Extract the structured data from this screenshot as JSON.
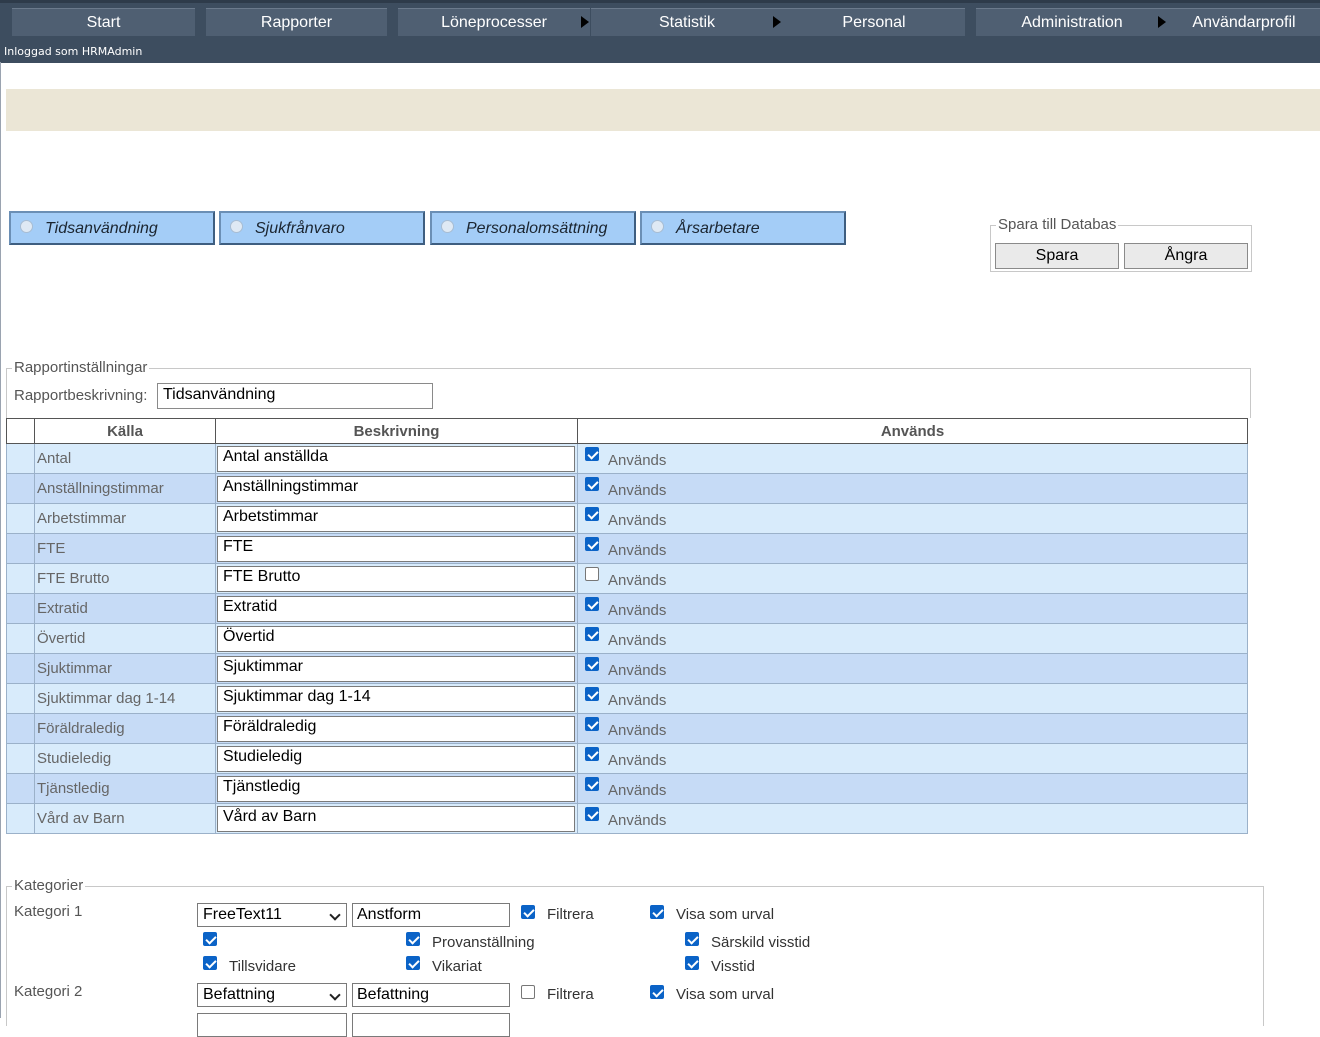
{
  "nav": {
    "items": [
      "Start",
      "Rapporter",
      "Löneprocesser",
      "Statistik",
      "Personal",
      "Administration",
      "Användarprofil"
    ],
    "logged_in": "Inloggad som HRMAdmin"
  },
  "report_tabs": [
    "Tidsanvändning",
    "Sjukfrånvaro",
    "Personalomsättning",
    "Årsarbetare"
  ],
  "save_panel": {
    "legend": "Spara till Databas",
    "save": "Spara",
    "undo": "Ångra"
  },
  "settings": {
    "legend": "Rapportinställningar",
    "description_label": "Rapportbeskrivning:",
    "description_value": "Tidsanvändning"
  },
  "table": {
    "headers": [
      "Källa",
      "Beskrivning",
      "Används"
    ],
    "used_label": "Används",
    "rows": [
      {
        "source": "Antal",
        "description": "Antal anställda",
        "used": true
      },
      {
        "source": "Anställningstimmar",
        "description": "Anställningstimmar",
        "used": true
      },
      {
        "source": "Arbetstimmar",
        "description": "Arbetstimmar",
        "used": true
      },
      {
        "source": "FTE",
        "description": "FTE",
        "used": true
      },
      {
        "source": "FTE Brutto",
        "description": "FTE Brutto",
        "used": false
      },
      {
        "source": "Extratid",
        "description": "Extratid",
        "used": true
      },
      {
        "source": "Övertid",
        "description": "Övertid",
        "used": true
      },
      {
        "source": "Sjuktimmar",
        "description": "Sjuktimmar",
        "used": true
      },
      {
        "source": "Sjuktimmar dag 1-14",
        "description": "Sjuktimmar dag 1-14",
        "used": true
      },
      {
        "source": "Föräldraledig",
        "description": "Föräldraledig",
        "used": true
      },
      {
        "source": "Studieledig",
        "description": "Studieledig",
        "used": true
      },
      {
        "source": "Tjänstledig",
        "description": "Tjänstledig",
        "used": true
      },
      {
        "source": "Vård av Barn",
        "description": "Vård av Barn",
        "used": true
      }
    ]
  },
  "categories": {
    "legend": "Kategorier",
    "cat1": {
      "label": "Kategori 1",
      "field": "FreeText11",
      "name": "Anstform",
      "filter_label": "Filtrera",
      "filter": true,
      "show_label": "Visa som urval",
      "show": true,
      "values": {
        "blank": true,
        "provanstallning": {
          "label": "Provanställning",
          "checked": true
        },
        "sarskild": {
          "label": "Särskild visstid",
          "checked": true
        },
        "tillsvidare": {
          "label": "Tillsvidare",
          "checked": true
        },
        "vikariat": {
          "label": "Vikariat",
          "checked": true
        },
        "visstid": {
          "label": "Visstid",
          "checked": true
        }
      }
    },
    "cat2": {
      "label": "Kategori 2",
      "field": "Befattning",
      "name": "Befattning",
      "filter_label": "Filtrera",
      "filter": false,
      "show_label": "Visa som urval",
      "show": true
    }
  }
}
